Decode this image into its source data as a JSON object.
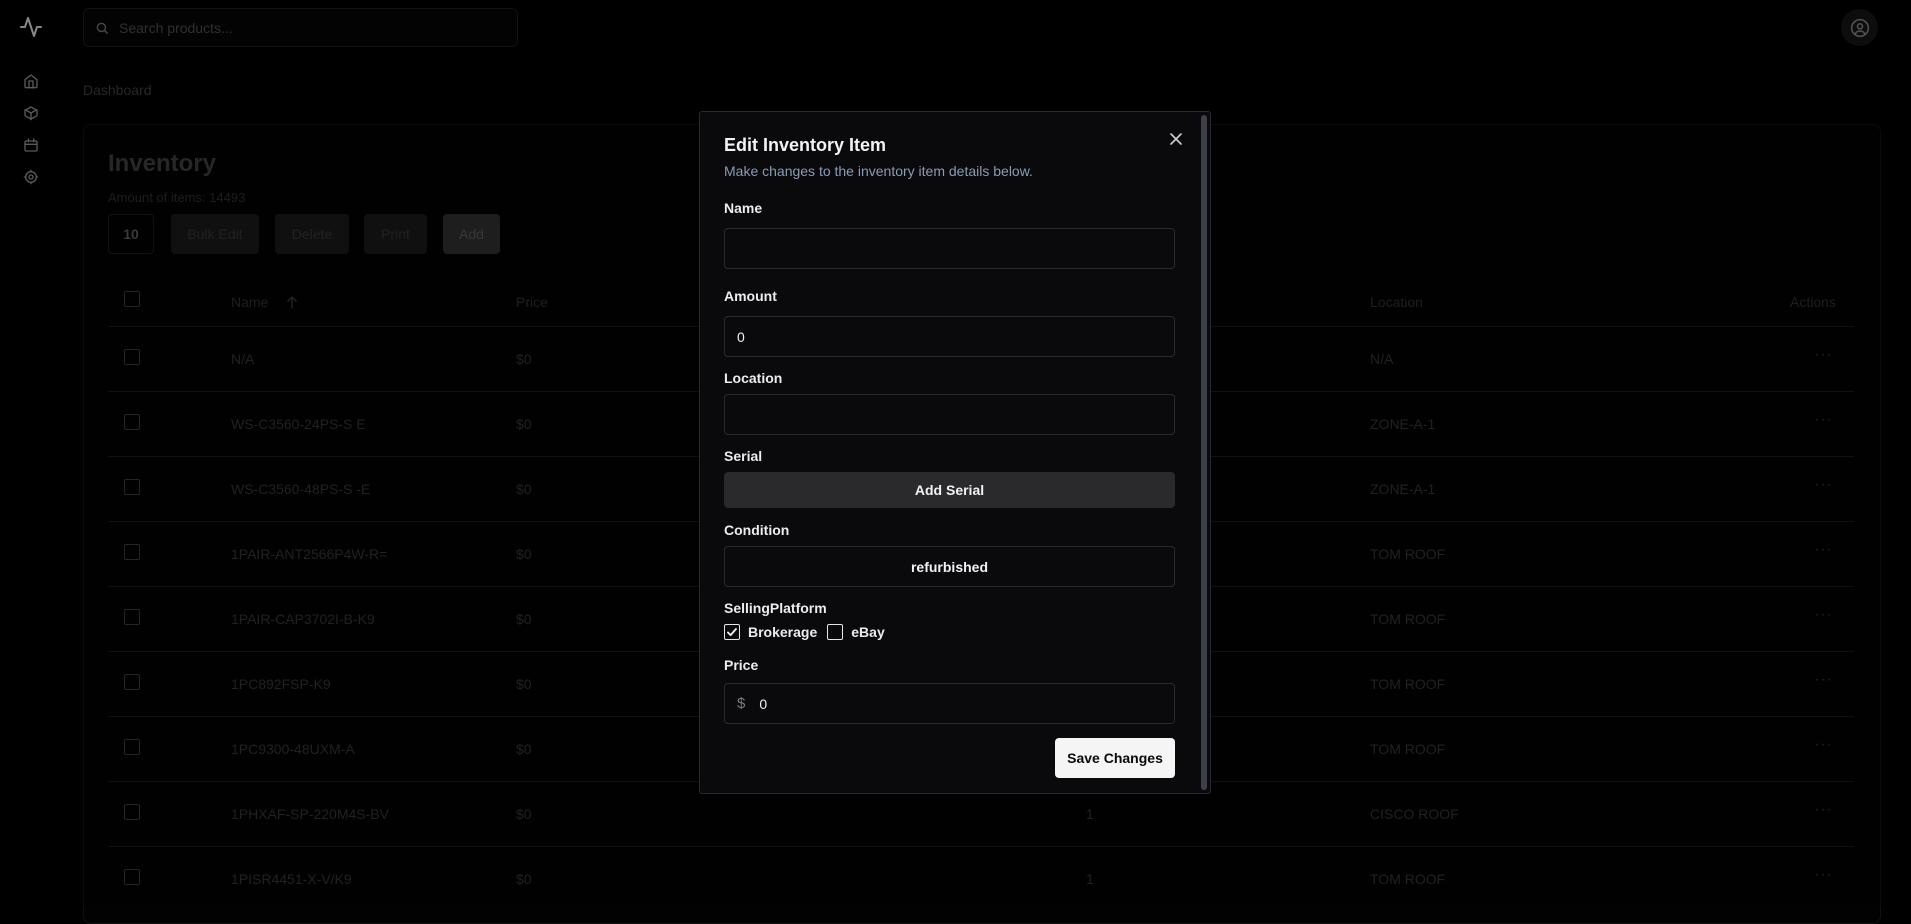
{
  "search": {
    "placeholder": "Search products..."
  },
  "breadcrumb": "Dashboard",
  "inventory": {
    "title": "Inventory",
    "count_label": "Amount of items: ",
    "count_value": "14493",
    "page_size": "10",
    "buttons": {
      "bulk_edit": "Bulk Edit",
      "delete": "Delete",
      "print": "Print",
      "add": "Add"
    },
    "columns": {
      "name": "Name",
      "price": "Price",
      "location": "Location",
      "actions": "Actions"
    },
    "sort_icon": "arrow-up-icon",
    "rows": [
      {
        "name": "N/A",
        "price": "$0",
        "amount": "",
        "location": "N/A"
      },
      {
        "name": "WS-C3560-24PS-S E",
        "price": "$0",
        "amount": "",
        "location": "ZONE-A-1"
      },
      {
        "name": "WS-C3560-48PS-S -E",
        "price": "$0",
        "amount": "",
        "location": "ZONE-A-1"
      },
      {
        "name": "1PAIR-ANT2566P4W-R=",
        "price": "$0",
        "amount": "",
        "location": "TOM ROOF"
      },
      {
        "name": "1PAIR-CAP3702I-B-K9",
        "price": "$0",
        "amount": "",
        "location": "TOM ROOF"
      },
      {
        "name": "1PC892FSP-K9",
        "price": "$0",
        "amount": "",
        "location": "TOM ROOF"
      },
      {
        "name": "1PC9300-48UXM-A",
        "price": "$0",
        "amount": "",
        "location": "TOM ROOF"
      },
      {
        "name": "1PHXAF-SP-220M4S-BV",
        "price": "$0",
        "amount": "1",
        "location": "CISCO ROOF"
      },
      {
        "name": "1PISR4451-X-V/K9",
        "price": "$0",
        "amount": "1",
        "location": "TOM ROOF"
      }
    ]
  },
  "modal": {
    "title": "Edit Inventory Item",
    "description": "Make changes to the inventory item details below.",
    "name_label": "Name",
    "name_value": "",
    "amount_label": "Amount",
    "amount_value": "0",
    "location_label": "Location",
    "location_value": "",
    "serial_label": "Serial",
    "add_serial_label": "Add Serial",
    "condition_label": "Condition",
    "condition_value": "refurbished",
    "selling_platform_label": "SellingPlatform",
    "platforms": [
      {
        "label": "Brokerage",
        "checked": true
      },
      {
        "label": "eBay",
        "checked": false
      }
    ],
    "price_label": "Price",
    "price_prefix": "$",
    "price_value": "0",
    "save_label": "Save Changes"
  },
  "icons": {
    "logo": "activity-pulse-icon",
    "nav": [
      "home-icon",
      "package-icon",
      "calendar-icon",
      "settings-icon"
    ],
    "avatar": "user-circle-icon"
  }
}
